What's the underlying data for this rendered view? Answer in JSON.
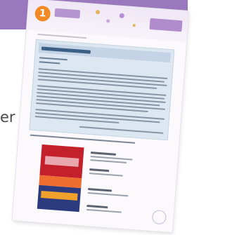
{
  "background": {
    "band_color": "#9a78bd",
    "side_word": "er"
  },
  "worksheet": {
    "unit_number": "1",
    "accent_color": "#f08a24",
    "header_color": "#b08ccc",
    "reading_box_color": "#dde7f1",
    "cover_colors": [
      "#c4202c",
      "#ef6d2f",
      "#2c3b7d",
      "#f0a12b"
    ]
  }
}
